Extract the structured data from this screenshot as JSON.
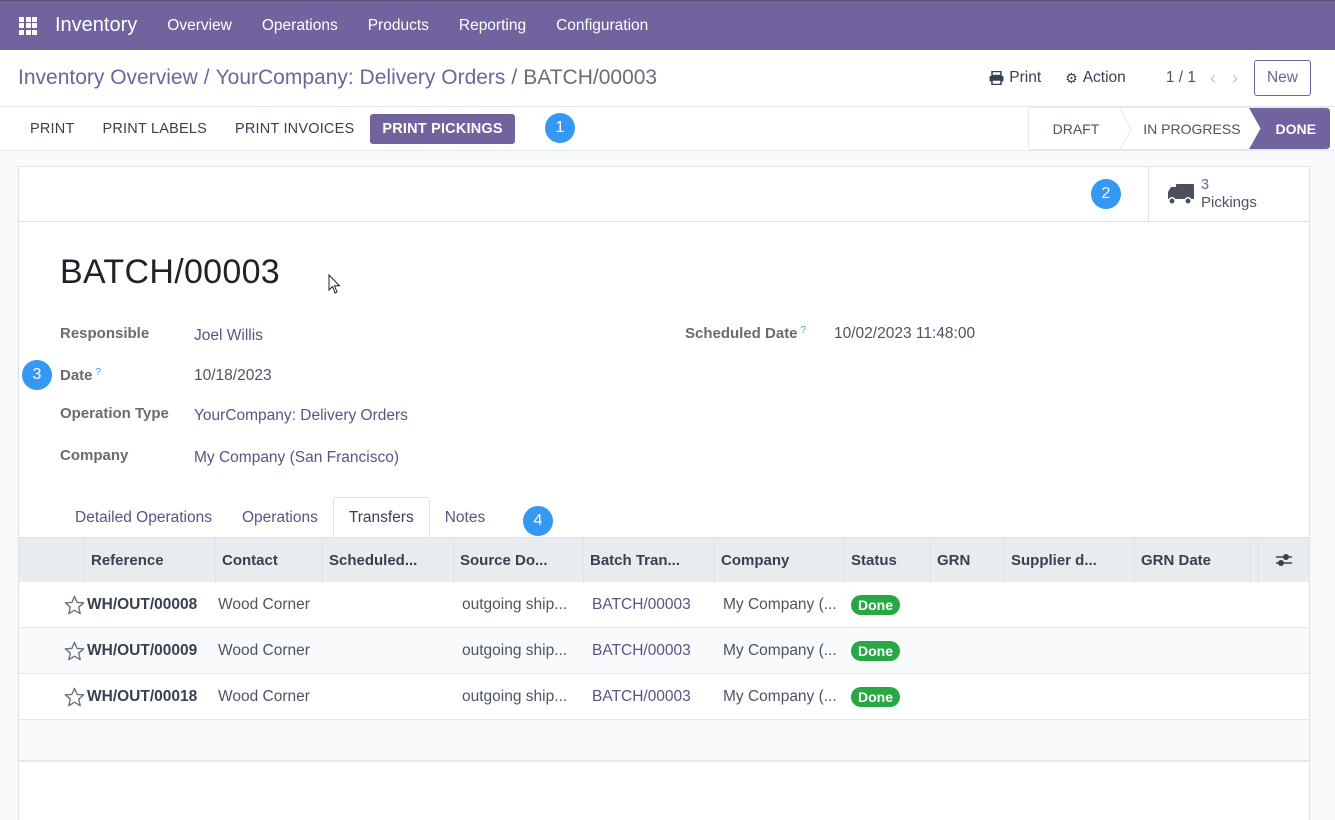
{
  "navbar": {
    "app_name": "Inventory",
    "menu": [
      "Overview",
      "Operations",
      "Products",
      "Reporting",
      "Configuration"
    ]
  },
  "breadcrumb": {
    "items": [
      "Inventory Overview",
      "YourCompany: Delivery Orders"
    ],
    "current": "BATCH/00003",
    "separator": "/"
  },
  "control": {
    "print_label": "Print",
    "action_label": "Action",
    "pager": "1 / 1",
    "new_label": "New"
  },
  "statusbar": {
    "buttons": [
      "PRINT",
      "PRINT LABELS",
      "PRINT INVOICES",
      "PRINT PICKINGS"
    ],
    "stages": [
      "DRAFT",
      "IN PROGRESS",
      "DONE"
    ],
    "current_stage": "DONE"
  },
  "annotations": [
    "1",
    "2",
    "3",
    "4"
  ],
  "smart_button": {
    "value": "3",
    "label": "Pickings"
  },
  "record": {
    "title": "BATCH/00003",
    "fields": {
      "responsible": {
        "label": "Responsible",
        "value": "Joel Willis"
      },
      "date": {
        "label": "Date",
        "help": "?",
        "value": "10/18/2023"
      },
      "operation_type": {
        "label": "Operation Type",
        "value": "YourCompany: Delivery Orders"
      },
      "company": {
        "label": "Company",
        "value": "My Company (San Francisco)"
      },
      "scheduled_date": {
        "label": "Scheduled Date",
        "help": "?",
        "value": "10/02/2023 11:48:00"
      }
    }
  },
  "tabs": [
    "Detailed Operations",
    "Operations",
    "Transfers",
    "Notes"
  ],
  "active_tab": "Transfers",
  "table": {
    "columns": [
      "Reference",
      "Contact",
      "Scheduled...",
      "Source Do...",
      "Batch Tran...",
      "Company",
      "Status",
      "GRN",
      "Supplier d...",
      "GRN Date"
    ],
    "rows": [
      {
        "reference": "WH/OUT/00008",
        "contact": "Wood Corner",
        "scheduled": "",
        "source": "outgoing ship...",
        "batch": "BATCH/00003",
        "company": "My Company (...",
        "status": "Done",
        "grn": "",
        "supplier": "",
        "grn_date": ""
      },
      {
        "reference": "WH/OUT/00009",
        "contact": "Wood Corner",
        "scheduled": "",
        "source": "outgoing ship...",
        "batch": "BATCH/00003",
        "company": "My Company (...",
        "status": "Done",
        "grn": "",
        "supplier": "",
        "grn_date": ""
      },
      {
        "reference": "WH/OUT/00018",
        "contact": "Wood Corner",
        "scheduled": "",
        "source": "outgoing ship...",
        "batch": "BATCH/00003",
        "company": "My Company (...",
        "status": "Done",
        "grn": "",
        "supplier": "",
        "grn_date": ""
      }
    ]
  },
  "colors": {
    "brand": "#71639e",
    "annotation": "#3598f3",
    "status_done": "#28a745"
  }
}
